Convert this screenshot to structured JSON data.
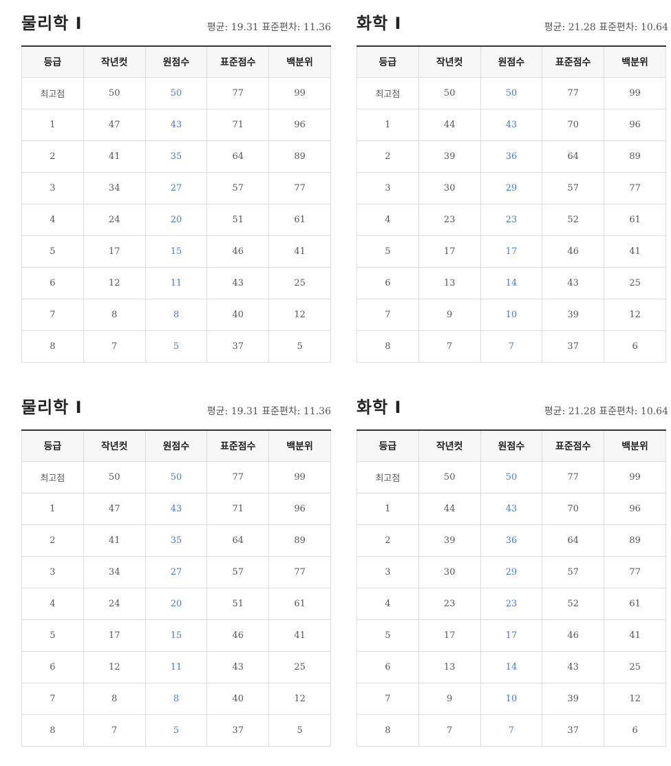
{
  "headers": [
    "등급",
    "작년컷",
    "원점수",
    "표준점수",
    "백분위"
  ],
  "panels": [
    {
      "title": "물리학 I",
      "stats": "평균: 19.31 표준편차: 11.36",
      "rows": [
        [
          "최고점",
          "50",
          "50",
          "77",
          "99"
        ],
        [
          "1",
          "47",
          "43",
          "71",
          "96"
        ],
        [
          "2",
          "41",
          "35",
          "64",
          "89"
        ],
        [
          "3",
          "34",
          "27",
          "57",
          "77"
        ],
        [
          "4",
          "24",
          "20",
          "51",
          "61"
        ],
        [
          "5",
          "17",
          "15",
          "46",
          "41"
        ],
        [
          "6",
          "12",
          "11",
          "43",
          "25"
        ],
        [
          "7",
          "8",
          "8",
          "40",
          "12"
        ],
        [
          "8",
          "7",
          "5",
          "37",
          "5"
        ]
      ]
    },
    {
      "title": "화학 I",
      "stats": "평균: 21.28 표준편차: 10.64",
      "rows": [
        [
          "최고점",
          "50",
          "50",
          "77",
          "99"
        ],
        [
          "1",
          "44",
          "43",
          "70",
          "96"
        ],
        [
          "2",
          "39",
          "36",
          "64",
          "89"
        ],
        [
          "3",
          "30",
          "29",
          "57",
          "77"
        ],
        [
          "4",
          "23",
          "23",
          "52",
          "61"
        ],
        [
          "5",
          "17",
          "17",
          "46",
          "41"
        ],
        [
          "6",
          "13",
          "14",
          "43",
          "25"
        ],
        [
          "7",
          "9",
          "10",
          "39",
          "12"
        ],
        [
          "8",
          "7",
          "7",
          "37",
          "6"
        ]
      ]
    },
    {
      "title": "물리학 I",
      "stats": "평균: 19.31 표준편차: 11.36",
      "rows": [
        [
          "최고점",
          "50",
          "50",
          "77",
          "99"
        ],
        [
          "1",
          "47",
          "43",
          "71",
          "96"
        ],
        [
          "2",
          "41",
          "35",
          "64",
          "89"
        ],
        [
          "3",
          "34",
          "27",
          "57",
          "77"
        ],
        [
          "4",
          "24",
          "20",
          "51",
          "61"
        ],
        [
          "5",
          "17",
          "15",
          "46",
          "41"
        ],
        [
          "6",
          "12",
          "11",
          "43",
          "25"
        ],
        [
          "7",
          "8",
          "8",
          "40",
          "12"
        ],
        [
          "8",
          "7",
          "5",
          "37",
          "5"
        ]
      ]
    },
    {
      "title": "화학 I",
      "stats": "평균: 21.28 표준편차: 10.64",
      "rows": [
        [
          "최고점",
          "50",
          "50",
          "77",
          "99"
        ],
        [
          "1",
          "44",
          "43",
          "70",
          "96"
        ],
        [
          "2",
          "39",
          "36",
          "64",
          "89"
        ],
        [
          "3",
          "30",
          "29",
          "57",
          "77"
        ],
        [
          "4",
          "23",
          "23",
          "52",
          "61"
        ],
        [
          "5",
          "17",
          "17",
          "46",
          "41"
        ],
        [
          "6",
          "13",
          "14",
          "43",
          "25"
        ],
        [
          "7",
          "9",
          "10",
          "39",
          "12"
        ],
        [
          "8",
          "7",
          "7",
          "37",
          "6"
        ]
      ]
    }
  ]
}
